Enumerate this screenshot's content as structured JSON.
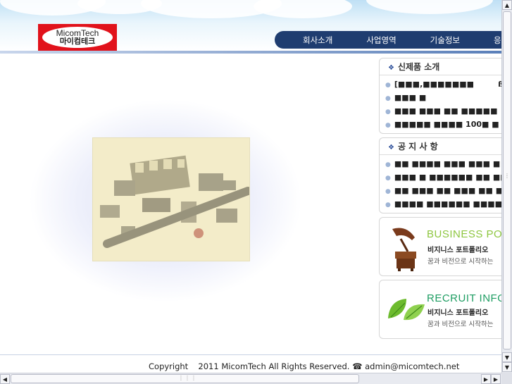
{
  "logo": {
    "en": "MicomTech",
    "ko": "마이컴테크"
  },
  "nav": [
    "회사소개",
    "사업영역",
    "기술정보",
    "응"
  ],
  "new_products": {
    "title": "신제품 소개",
    "items": [
      "[■■■,■■■■■■■ ᅟᅟᅟß..",
      "■■■ ■",
      "■■■ ■■■ ■■ ■■■■■",
      "■■■■■ ■■■■ 100■ ■"
    ]
  },
  "notice": {
    "title": "공 지 사 항",
    "items": [
      "■■ ■■■■ ■■■ ■■■ ■",
      "■■■ ■ ■■■■■■ ■■ ■■",
      "■■ ■■■ ■■ ■■■ ■■ ■",
      "■■■■ ■■■■■■ ■■■■ ■"
    ]
  },
  "banners": [
    {
      "title": "BUSINESS PORTFOLIO",
      "color": "#8dc63f",
      "ko": "비지니스 포트폴리오",
      "sub": "꿈과 비전으로 시작하는",
      "icon": "gramophone-icon"
    },
    {
      "title": "RECRUIT INFO",
      "color": "#1e9d62",
      "ko": "비지니스 포트폴리오",
      "sub": "꿈과 비전으로 시작하는",
      "icon": "leaf-icon"
    }
  ],
  "footer": {
    "copyright": "Copyrightᅟ 2011 MicomTech All Rights Reserved.",
    "phone_icon": "☎",
    "email": "admin@micomtech.net"
  },
  "colors": {
    "nav_bg": "#1f3d70",
    "logo_red": "#e1121b",
    "bullet": "#2d4f9a"
  }
}
